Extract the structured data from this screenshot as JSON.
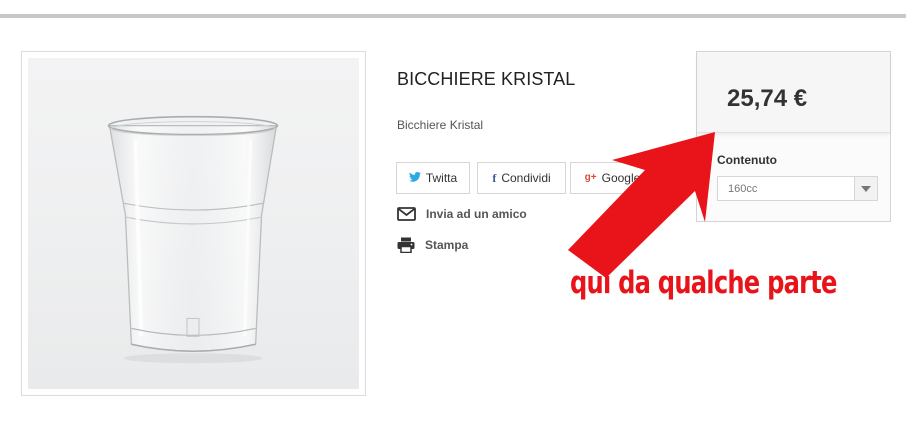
{
  "product": {
    "title": "BICCHIERE KRISTAL",
    "short_description": "Bicchiere Kristal",
    "image_icon": "plastic-cup-image"
  },
  "social": {
    "twitter_label": "Twitta",
    "facebook_label": "Condividi",
    "google_label": "Google+"
  },
  "actions": {
    "send_to_friend": "Invia ad un amico",
    "print": "Stampa"
  },
  "price_box": {
    "price": "25,74 €",
    "attribute_label": "Contenuto",
    "attribute_selected": "160cc"
  },
  "annotation": {
    "text": "qui da qualche parte",
    "color": "#e8141a"
  },
  "colors": {
    "twitter": "#2ba9e1",
    "facebook": "#3b5998",
    "google": "#dd4b39"
  }
}
